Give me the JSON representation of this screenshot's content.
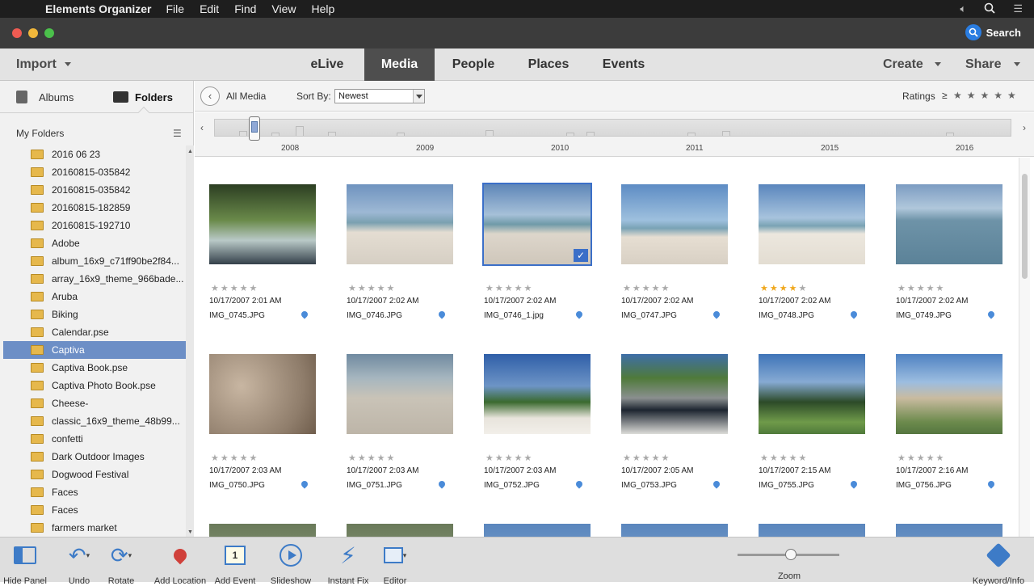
{
  "menubar": {
    "app_name": "Elements Organizer",
    "items": [
      "File",
      "Edit",
      "Find",
      "View",
      "Help"
    ]
  },
  "titlebar": {
    "search_label": "Search"
  },
  "navbar": {
    "import_label": "Import",
    "tabs": [
      "eLive",
      "Media",
      "People",
      "Places",
      "Events"
    ],
    "active_tab": "Media",
    "create_label": "Create",
    "share_label": "Share"
  },
  "leftpanel": {
    "albums_label": "Albums",
    "folders_label": "Folders",
    "section_title": "My Folders",
    "folders": [
      "2016 06 23",
      "20160815-035842",
      "20160815-035842",
      "20160815-182859",
      "20160815-192710",
      "Adobe",
      "album_16x9_c71ff90be2f84...",
      "array_16x9_theme_966bade...",
      "Aruba",
      "Biking",
      "Calendar.pse",
      "Captiva",
      "Captiva Book.pse",
      "Captiva Photo Book.pse",
      "Cheese-",
      "classic_16x9_theme_48b99...",
      "confetti",
      "Dark Outdoor Images",
      "Dogwood Festival",
      "Faces",
      "Faces",
      "farmers market"
    ],
    "selected_folder": "Captiva"
  },
  "mediabar": {
    "all_media_label": "All Media",
    "sort_label": "Sort By:",
    "sort_value": "Newest",
    "ratings_label": "Ratings",
    "ratings_op": "≥"
  },
  "timeline": {
    "years": [
      "2008",
      "2009",
      "2010",
      "2011",
      "2015",
      "2016"
    ]
  },
  "photos": [
    {
      "date": "10/17/2007 2:01 AM",
      "name": "IMG_0745.JPG",
      "rating": 0,
      "selected": false
    },
    {
      "date": "10/17/2007 2:02 AM",
      "name": "IMG_0746.JPG",
      "rating": 0,
      "selected": false
    },
    {
      "date": "10/17/2007 2:02 AM",
      "name": "IMG_0746_1.jpg",
      "rating": 0,
      "selected": true
    },
    {
      "date": "10/17/2007 2:02 AM",
      "name": "IMG_0747.JPG",
      "rating": 0,
      "selected": false
    },
    {
      "date": "10/17/2007 2:02 AM",
      "name": "IMG_0748.JPG",
      "rating": 4,
      "selected": false
    },
    {
      "date": "10/17/2007 2:02 AM",
      "name": "IMG_0749.JPG",
      "rating": 0,
      "selected": false
    },
    {
      "date": "10/17/2007 2:03 AM",
      "name": "IMG_0750.JPG",
      "rating": 0,
      "selected": false
    },
    {
      "date": "10/17/2007 2:03 AM",
      "name": "IMG_0751.JPG",
      "rating": 0,
      "selected": false
    },
    {
      "date": "10/17/2007 2:03 AM",
      "name": "IMG_0752.JPG",
      "rating": 0,
      "selected": false
    },
    {
      "date": "10/17/2007 2:05 AM",
      "name": "IMG_0753.JPG",
      "rating": 0,
      "selected": false
    },
    {
      "date": "10/17/2007 2:15 AM",
      "name": "IMG_0755.JPG",
      "rating": 0,
      "selected": false
    },
    {
      "date": "10/17/2007 2:16 AM",
      "name": "IMG_0756.JPG",
      "rating": 0,
      "selected": false
    }
  ],
  "bottombar": {
    "hide_panel": "Hide Panel",
    "undo": "Undo",
    "rotate": "Rotate",
    "add_location": "Add Location",
    "add_event": "Add Event",
    "slideshow": "Slideshow",
    "instant_fix": "Instant Fix",
    "editor": "Editor",
    "zoom": "Zoom",
    "keyword_info": "Keyword/Info",
    "zoom_level": 0.52
  },
  "colors": {
    "accent": "#3b6fc8",
    "selected_row": "#6d8fc6",
    "star_on": "#f0a81e",
    "folder": "#e6b84c"
  }
}
